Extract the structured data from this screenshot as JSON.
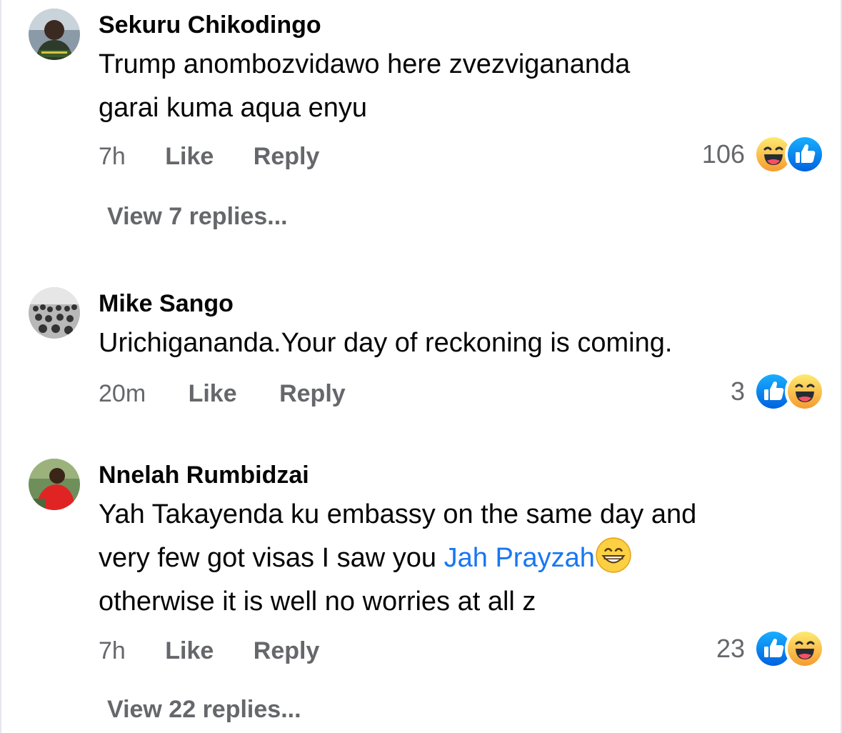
{
  "comments": [
    {
      "author": "Sekuru Chikodingo",
      "lines": [
        "Trump anombozvidawo here zvezvigananda",
        "garai kuma aqua enyu"
      ],
      "time": "7h",
      "like_label": "Like",
      "reply_label": "Reply",
      "reaction_count": "106",
      "reactions": [
        "laugh-icon",
        "like-icon"
      ],
      "view_replies": "View 7 replies..."
    },
    {
      "author": "Mike Sango",
      "lines": [
        "Urichigananda.Your day of reckoning is coming."
      ],
      "time": "20m",
      "like_label": "Like",
      "reply_label": "Reply",
      "reaction_count": "3",
      "reactions": [
        "like-icon",
        "laugh-icon"
      ]
    },
    {
      "author": "Nnelah Rumbidzai",
      "line1": "Yah Takayenda ku embassy on the same day and",
      "line2_prefix": "very few got visas I saw you ",
      "mention": "Jah Prayzah",
      "line3": "otherwise it is well no worries at all z",
      "time": "7h",
      "like_label": "Like",
      "reply_label": "Reply",
      "reaction_count": "23",
      "reactions": [
        "like-icon",
        "laugh-icon"
      ],
      "view_replies": "View 22 replies..."
    }
  ],
  "colors": {
    "text": "#050505",
    "secondary": "#65676b",
    "like_blue": "#1877f2",
    "emoji_yellow": "#f7b125"
  }
}
